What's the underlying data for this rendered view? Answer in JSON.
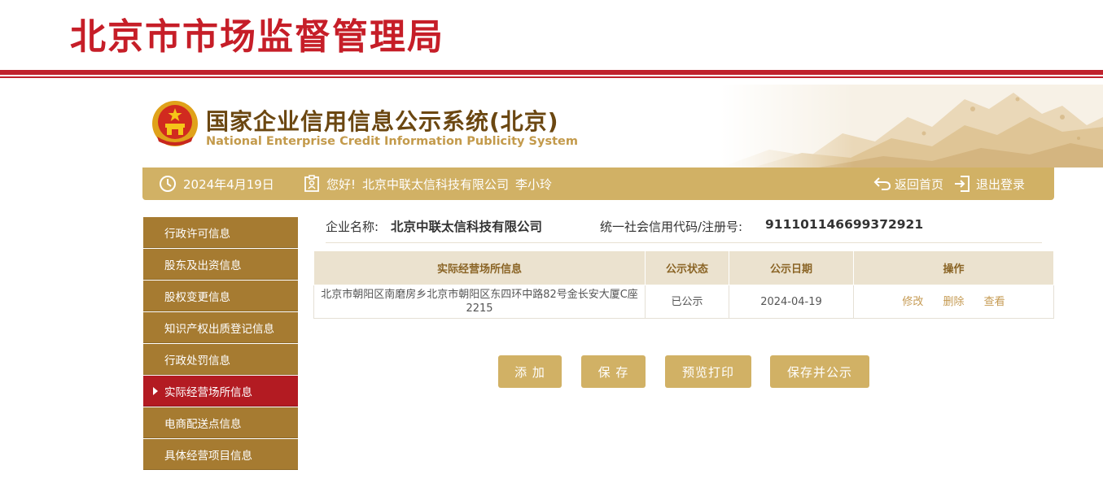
{
  "agency": {
    "title": "北京市市场监督管理局"
  },
  "system": {
    "title_cn": "国家企业信用信息公示系统(北京)",
    "title_en": "National Enterprise Credit Information Publicity System"
  },
  "info_bar": {
    "date": "2024年4月19日",
    "greeting": "您好!",
    "company": "北京中联太信科技有限公司",
    "user": "李小玲",
    "home_label": "返回首页",
    "logout_label": "退出登录"
  },
  "sidebar": {
    "items": [
      {
        "label": "行政许可信息",
        "active": false
      },
      {
        "label": "股东及出资信息",
        "active": false
      },
      {
        "label": "股权变更信息",
        "active": false
      },
      {
        "label": "知识产权出质登记信息",
        "active": false
      },
      {
        "label": "行政处罚信息",
        "active": false
      },
      {
        "label": "实际经营场所信息",
        "active": true
      },
      {
        "label": "电商配送点信息",
        "active": false
      },
      {
        "label": "具体经营项目信息",
        "active": false
      }
    ]
  },
  "company": {
    "name_label": "企业名称:",
    "name": "北京中联太信科技有限公司",
    "code_label": "统一社会信用代码/注册号:",
    "code": "911101146699372921"
  },
  "table": {
    "headers": [
      "实际经营场所信息",
      "公示状态",
      "公示日期",
      "操作"
    ],
    "rows": [
      {
        "address": "北京市朝阳区南磨房乡北京市朝阳区东四环中路82号金长安大厦C座2215",
        "status": "已公示",
        "date": "2024-04-19",
        "ops": [
          "修改",
          "删除",
          "查看"
        ]
      }
    ]
  },
  "buttons": {
    "add": "添 加",
    "save": "保 存",
    "preview": "预览打印",
    "save_publish": "保存并公示"
  },
  "colors": {
    "brand_red": "#c61e28",
    "gold": "#d1b165",
    "sidebar": "#a67b31",
    "active": "#b31b22"
  }
}
